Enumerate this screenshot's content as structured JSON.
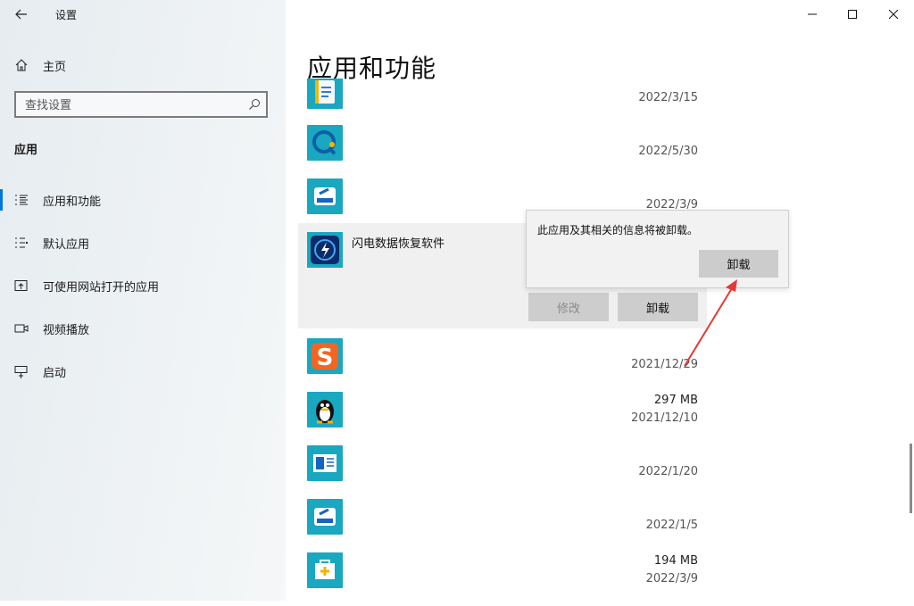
{
  "window": {
    "title": "设置",
    "back_label": "返回",
    "controls": {
      "minimize": "minimize-icon",
      "maximize": "maximize-icon",
      "close": "close-icon"
    }
  },
  "sidebar": {
    "home_label": "主页",
    "search_placeholder": "查找设置",
    "section_title": "应用",
    "items": [
      {
        "label": "应用和功能",
        "icon": "apps-list-icon",
        "active": true
      },
      {
        "label": "默认应用",
        "icon": "default-apps-icon",
        "active": false
      },
      {
        "label": "可使用网站打开的应用",
        "icon": "open-in-web-icon",
        "active": false
      },
      {
        "label": "视频播放",
        "icon": "video-playback-icon",
        "active": false
      },
      {
        "label": "启动",
        "icon": "startup-icon",
        "active": false
      }
    ]
  },
  "main": {
    "page_title": "应用和功能",
    "apps": [
      {
        "name": "",
        "size": "",
        "date": "2022/3/15",
        "icon": "notebook-app-icon"
      },
      {
        "name": "",
        "size": "",
        "date": "2022/5/30",
        "icon": "chat-bubble-app-icon"
      },
      {
        "name": "",
        "size": "",
        "date": "2022/3/9",
        "icon": "drive-tool-app-icon"
      },
      {
        "name": "",
        "size": "",
        "date": "2021/12/29",
        "icon": "sogou-input-icon"
      },
      {
        "name": "",
        "size": "297 MB",
        "date": "2021/12/10",
        "icon": "qq-penguin-icon"
      },
      {
        "name": "",
        "size": "",
        "date": "2022/1/20",
        "icon": "document-window-app-icon"
      },
      {
        "name": "",
        "size": "",
        "date": "2022/1/5",
        "icon": "drive-tool-app-icon"
      },
      {
        "name": "",
        "size": "194 MB",
        "date": "2022/3/9",
        "icon": "toolbox-app-icon"
      }
    ],
    "selected_app": {
      "name": "闪电数据恢复软件",
      "icon": "lightning-recovery-app-icon",
      "modify_label": "修改",
      "uninstall_label": "卸载"
    }
  },
  "flyout": {
    "message": "此应用及其相关的信息将被卸载。",
    "confirm_label": "卸载"
  },
  "colors": {
    "accent": "#0078d7",
    "app_tile": "#1aa7c0",
    "annotation_arrow": "#e53935"
  }
}
